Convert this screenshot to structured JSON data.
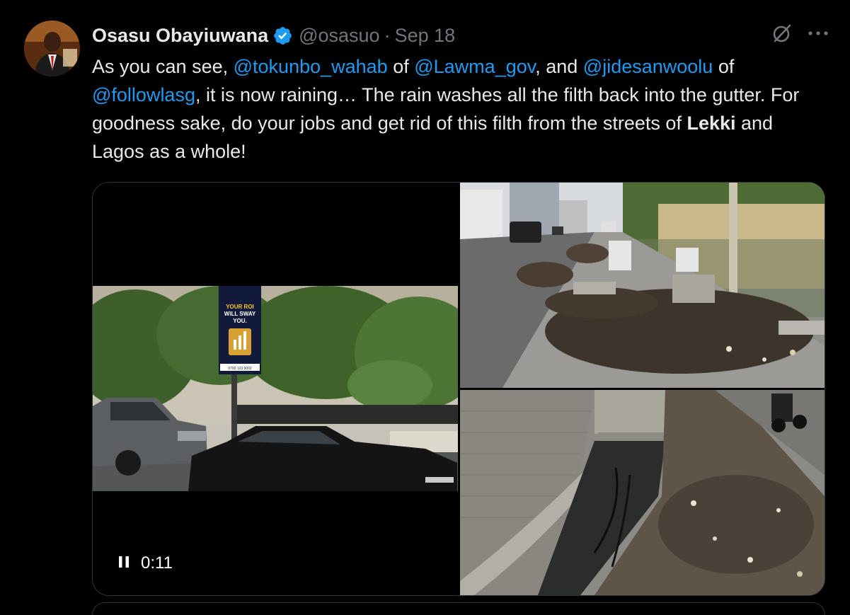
{
  "author": {
    "name": "Osasu Obayiuwana",
    "handle": "@osasuo",
    "separator": "·",
    "date": "Sep 18"
  },
  "icons": {
    "verified": "verified-badge-icon",
    "grok": "grok-icon",
    "more": "more-icon",
    "pause": "pause-icon"
  },
  "colors": {
    "background": "#000000",
    "text": "#e7e9ea",
    "secondary": "#71767b",
    "mention": "#1d9bf0",
    "border": "#2f3336"
  },
  "tweet": {
    "segments": [
      {
        "text": "As you can see, ",
        "kind": "plain"
      },
      {
        "text": "@tokunbo_wahab",
        "kind": "mention"
      },
      {
        "text": " of ",
        "kind": "plain"
      },
      {
        "text": "@Lawma_gov",
        "kind": "mention"
      },
      {
        "text": ", and ",
        "kind": "plain"
      },
      {
        "text": "@jidesanwoolu",
        "kind": "mention"
      },
      {
        "text": " of ",
        "kind": "plain"
      },
      {
        "text": "@followlasg",
        "kind": "mention"
      },
      {
        "text": ", it is now raining… The rain washes all the filth back into the gutter. For goodness sake, do your jobs and get rid of this filth from the streets of ",
        "kind": "plain"
      },
      {
        "text": "Lekki",
        "kind": "bold"
      },
      {
        "text": " and Lagos as a whole!",
        "kind": "plain"
      }
    ]
  },
  "video": {
    "timecode": "0:11",
    "billboard_line1": "YOUR ROI",
    "billboard_line2": "WILL SWAY",
    "billboard_line3": "YOU.",
    "billboard_phone": "0700 123 9002"
  }
}
